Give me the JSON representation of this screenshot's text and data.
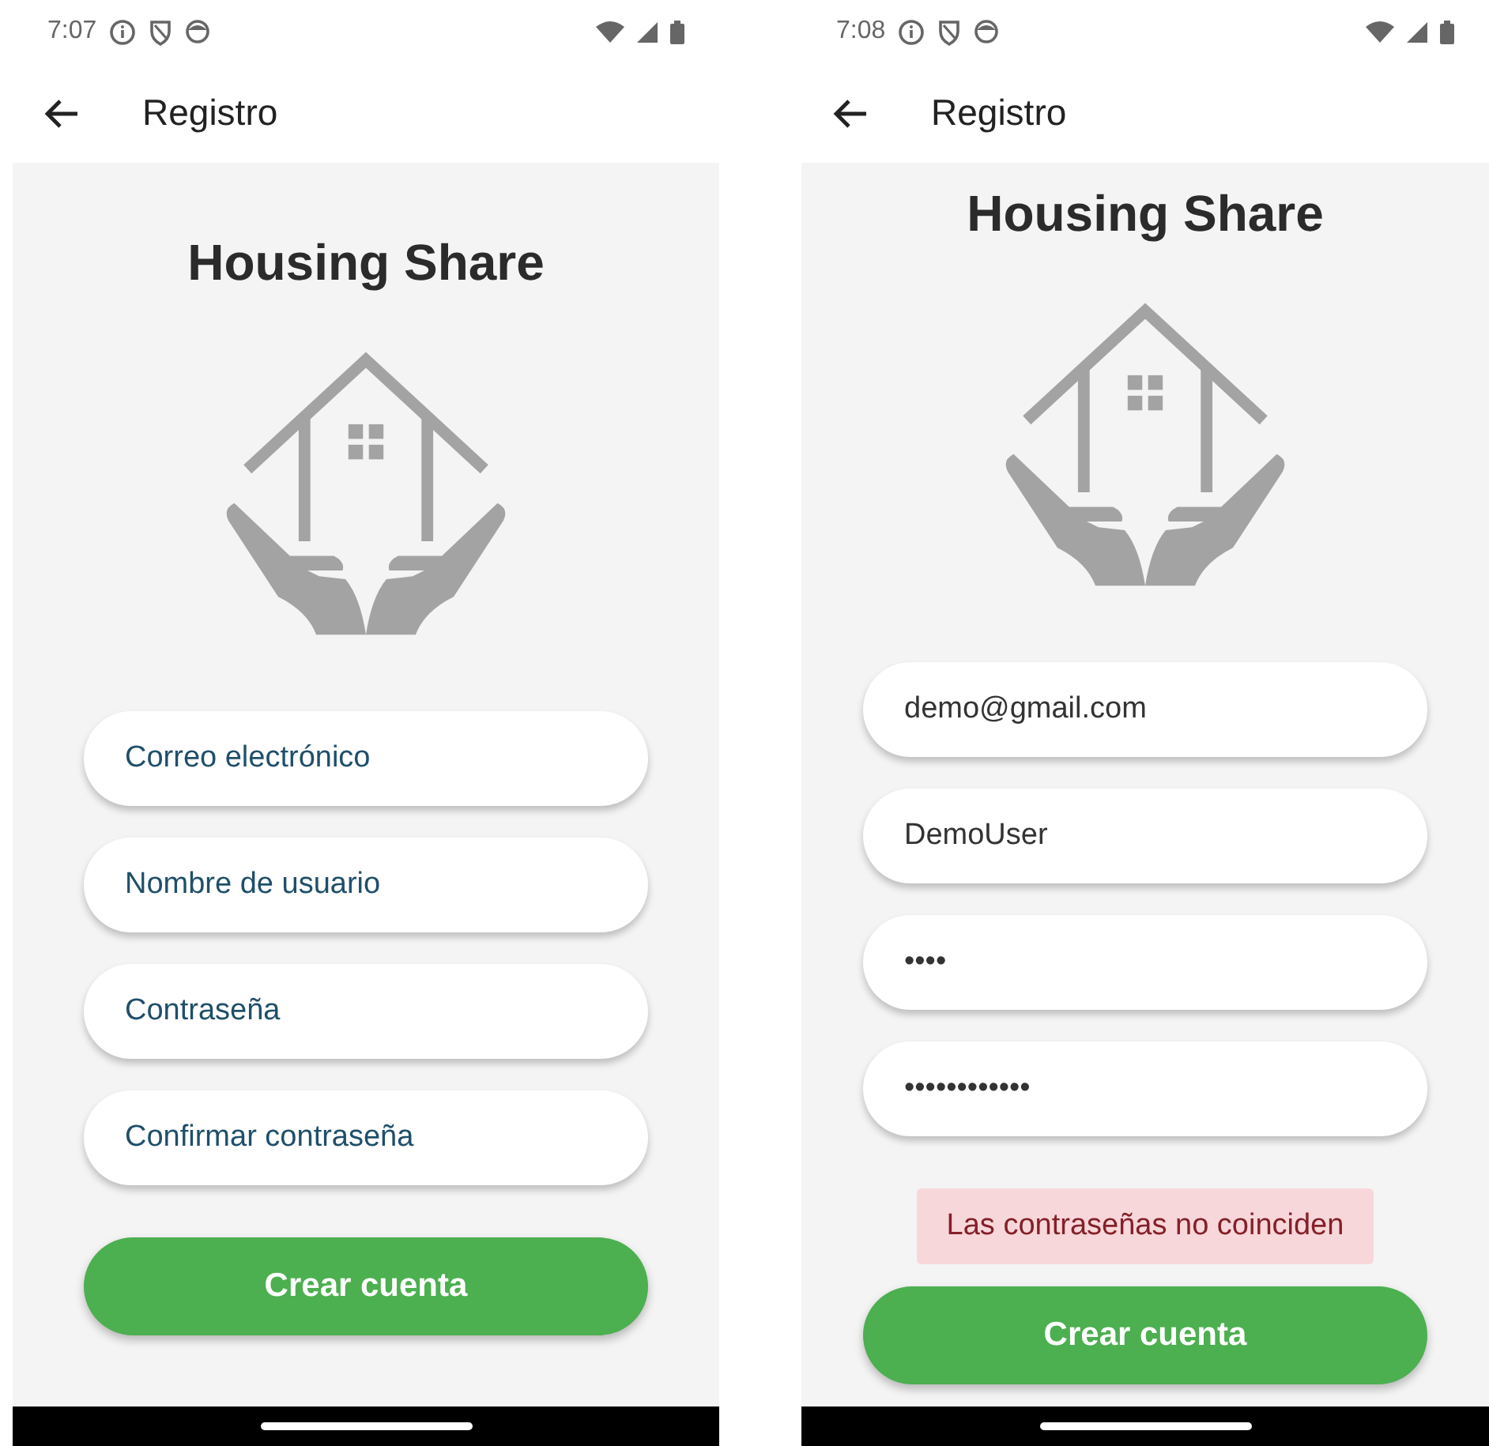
{
  "screens": [
    {
      "status_bar": {
        "time": "7:07"
      },
      "app_bar": {
        "title": "Registro"
      },
      "app_name": "Housing Share",
      "fields": [
        {
          "placeholder": "Correo electrónico"
        },
        {
          "placeholder": "Nombre de usuario"
        },
        {
          "placeholder": "Contraseña"
        },
        {
          "placeholder": "Confirmar contraseña"
        }
      ],
      "button": "Crear cuenta"
    },
    {
      "status_bar": {
        "time": "7:08"
      },
      "app_bar": {
        "title": "Registro"
      },
      "app_name": "Housing Share",
      "fields": [
        {
          "value": "demo@gmail.com"
        },
        {
          "value": "DemoUser"
        },
        {
          "value": "••••"
        },
        {
          "value": "••••••••••••"
        }
      ],
      "error": "Las contraseñas no coinciden",
      "button": "Crear cuenta"
    }
  ]
}
